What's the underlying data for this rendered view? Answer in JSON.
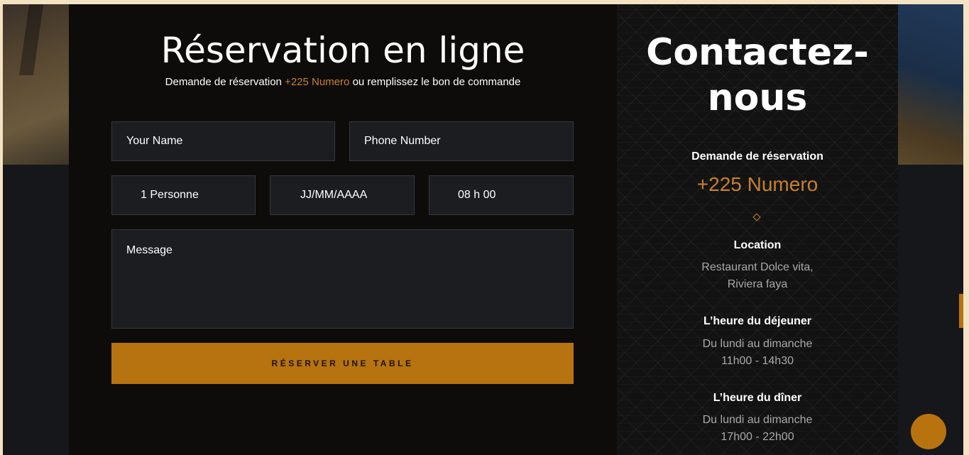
{
  "booking": {
    "title": "Réservation en ligne",
    "subtitle_prefix": "Demande de réservation",
    "subtitle_phone": "+225 Numero",
    "subtitle_suffix": "ou remplissez le bon de commande",
    "form": {
      "name_placeholder": "Your Name",
      "phone_placeholder": "Phone Number",
      "persons_value": "1 Personne",
      "date_placeholder": "JJ/MM/AAAA",
      "time_value": "08 h 00",
      "message_placeholder": "Message",
      "submit_label": "RÉSERVER UNE TABLE"
    }
  },
  "contact": {
    "title": "Contactez-nous",
    "reservation_label": "Demande de réservation",
    "reservation_phone": "+225 Numero",
    "location_label": "Location",
    "location_line1": "Restaurant Dolce vita,",
    "location_line2": "Riviera faya",
    "lunch_label": "L’heure du déjeuner",
    "lunch_days": "Du lundi au dimanche",
    "lunch_hours": "11h00 - 14h30",
    "dinner_label": "L’heure du dîner",
    "dinner_days": "Du lundi au dimanche",
    "dinner_hours": "17h00 - 22h00"
  },
  "colors": {
    "accent": "#b6730f",
    "accent_text": "#c8812a",
    "panel": "#0d0c0b",
    "field_bg": "#1b1d20"
  }
}
